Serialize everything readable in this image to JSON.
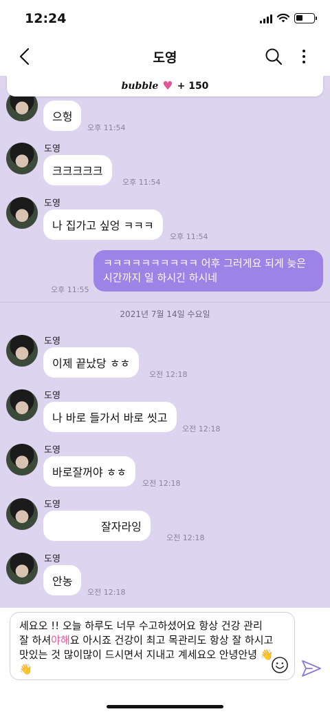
{
  "status_bar": {
    "time": "12:24"
  },
  "header": {
    "title": "도영"
  },
  "banner": {
    "brand": "bubble",
    "points": "+ 150"
  },
  "messages": [
    {
      "sender": "",
      "text": "으헝",
      "time": "오후 11:54"
    },
    {
      "sender": "도영",
      "text": "크크크크크",
      "time": "오후 11:54"
    },
    {
      "sender": "도영",
      "text": "나 집가고 싶엉 ㅋㅋㅋ",
      "time": "오후 11:54"
    },
    {
      "sender": "me",
      "text": "ㅋㅋㅋㅋㅋㅋㅋㅋㅋㅋ 어후 그러게요 되게 늦은 시간까지 일 하시긴 하시네",
      "time": "오후 11:55"
    },
    {
      "sender": "도영",
      "text": "이제 끝났당 ㅎㅎ",
      "time": "오전 12:18"
    },
    {
      "sender": "도영",
      "text": "나 바로 들가서 바로 씻고",
      "time": "오전 12:18"
    },
    {
      "sender": "도영",
      "text": "바로잘꺼야 ㅎㅎ",
      "time": "오전 12:18"
    },
    {
      "sender": "도영",
      "text": "잘자라잉",
      "time": "오전 12:18"
    },
    {
      "sender": "도영",
      "text": "안농",
      "time": "오전 12:18"
    }
  ],
  "date_separator": "2021년 7월 14일 수요일",
  "composer": {
    "text_part1": "세요오 !! 오늘 하루도 너무 수고하셨어요 항상 건강 관리 잘 하셔",
    "text_highlight": "야해",
    "text_part2": "요 아시죠 건강이 최고 목관리도 항상 잘 하시고 맛있는 것 많이많이 드시면서 지내고 계세요오 안녕안녕 👋👋"
  },
  "colors": {
    "chat_background": "#ddd4ef",
    "outgoing_bubble": "#9c83e6",
    "heart": "#e0569a"
  }
}
